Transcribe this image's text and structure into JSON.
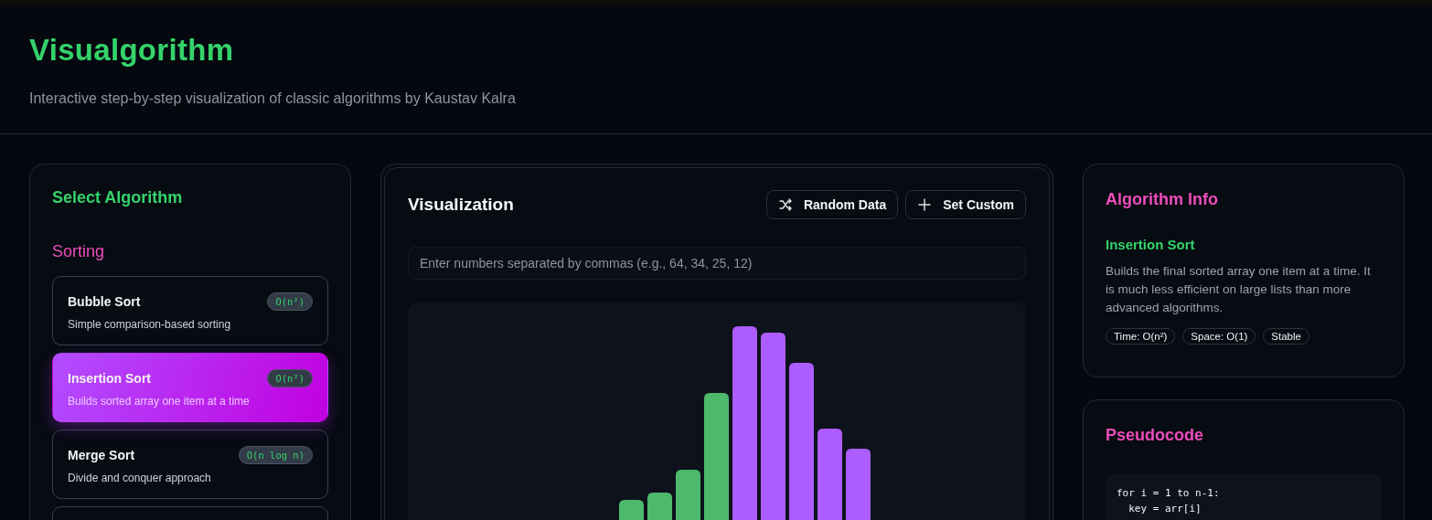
{
  "header": {
    "title": "Visualgorithm",
    "subtitle": "Interactive step-by-step visualization of classic algorithms by Kaustav Kalra"
  },
  "sidebar": {
    "title": "Select Algorithm",
    "section": "Sorting",
    "items": [
      {
        "name": "Bubble Sort",
        "complexity": "O(n²)",
        "description": "Simple comparison-based sorting",
        "selected": false
      },
      {
        "name": "Insertion Sort",
        "complexity": "O(n²)",
        "description": "Builds sorted array one item at a time",
        "selected": true
      },
      {
        "name": "Merge Sort",
        "complexity": "O(n log n)",
        "description": "Divide and conquer approach",
        "selected": false
      },
      {
        "selected": false
      }
    ]
  },
  "visualization": {
    "title": "Visualization",
    "buttons": [
      {
        "kind": "shuffle",
        "label": "Random Data"
      },
      {
        "kind": "plus",
        "label": "Set Custom"
      }
    ],
    "input": {
      "placeholder": "Enter numbers separated by commas (e.g., 64, 34, 25, 12)"
    },
    "bars": [
      {
        "sorted": true
      },
      {
        "sorted": true
      },
      {
        "sorted": true
      },
      {
        "sorted": true
      },
      {
        "sorted": false
      },
      {
        "sorted": false
      },
      {
        "sorted": false
      },
      {
        "sorted": false
      },
      {
        "sorted": false
      }
    ]
  },
  "info": {
    "title": "Algorithm Info",
    "name": "Insertion Sort",
    "description": "Builds the final sorted array one item at a time. It is much less efficient on large lists than more advanced algorithms.",
    "tags": [
      "Time: O(n²)",
      "Space: O(1)",
      "Stable"
    ]
  },
  "pseudocode": {
    "title": "Pseudocode",
    "lines": [
      "for i = 1 to n-1:",
      "  key = arr[i]"
    ]
  }
}
